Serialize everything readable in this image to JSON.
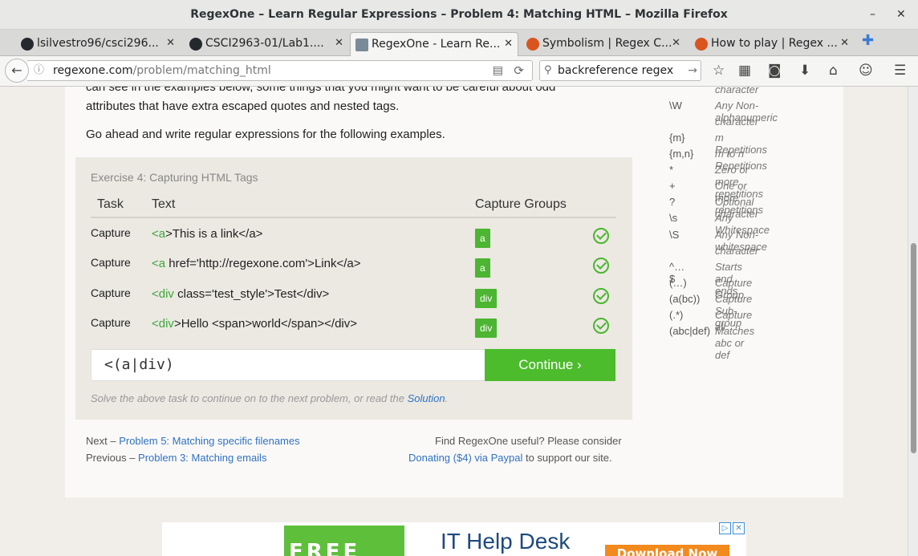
{
  "window": {
    "title": "RegexOne – Learn Regular Expressions – Problem 4: Matching HTML – Mozilla Firefox",
    "minimize": "–",
    "close": "✕"
  },
  "tabs": [
    {
      "label": "lsilvestro96/csci296...",
      "icon_color": "#24292e",
      "icon": "github-icon"
    },
    {
      "label": "CSCI2963-01/Lab1....",
      "icon_color": "#24292e",
      "icon": "github-icon"
    },
    {
      "label": "RegexOne - Learn Re...",
      "icon_color": "#7a8a99",
      "icon": "regexone-icon"
    },
    {
      "label": "Symbolism | Regex C...",
      "icon_color": "#d9541e",
      "icon": "crossword-icon"
    },
    {
      "label": "How to play | Regex ...",
      "icon_color": "#d9541e",
      "icon": "crossword-icon"
    }
  ],
  "tab_close": "✕",
  "new_tab": "✚",
  "nav": {
    "back": "←",
    "url_host": "regexone.com",
    "url_path": "/problem/matching_html",
    "reader": "▤",
    "reload": "⟳",
    "search_value": "backreference regex",
    "search_go": "→",
    "info": "ⓘ",
    "search_icon": "⚲"
  },
  "toolbar_icons": [
    "☆",
    "▦",
    "◙",
    "⬇",
    "⌂",
    "☺",
    "☰"
  ],
  "intro": {
    "line1": "can see in the examples below, some things that you might want to be careful about odd",
    "line2": "attributes that have extra escaped quotes and nested tags.",
    "line3": "Go ahead and write regular expressions for the following examples."
  },
  "exercise": {
    "title": "Exercise 4: Capturing HTML Tags",
    "headers": {
      "task": "Task",
      "text": "Text",
      "groups": "Capture Groups"
    },
    "rows": [
      {
        "task": "Capture",
        "hl": "<a",
        "rest": ">This is a link</a>",
        "group": "a"
      },
      {
        "task": "Capture",
        "hl": "<a",
        "rest": " href='http://regexone.com'>Link</a>",
        "group": "a"
      },
      {
        "task": "Capture",
        "hl": "<div",
        "rest": " class='test_style'>Test</div>",
        "group": "div"
      },
      {
        "task": "Capture",
        "hl": "<div",
        "rest": ">Hello <span>world</span></div>",
        "group": "div"
      }
    ],
    "answer": "<(a|div)",
    "continue": "Continue ›",
    "solve_prefix": "Solve the above task to continue on to the next problem, or read the ",
    "solve_link": "Solution",
    "solve_suffix": "."
  },
  "footer": {
    "next_prefix": "Next – ",
    "next_link": "Problem 5: Matching specific filenames",
    "prev_prefix": "Previous – ",
    "prev_link": "Problem 3: Matching emails",
    "useful": "Find RegexOne useful? Please consider",
    "donate_link": "Donating ($4) via Paypal",
    "donate_suffix": " to support our site."
  },
  "cheatsheet": [
    {
      "k": "",
      "v": "character"
    },
    {
      "k": "\\W",
      "v": "Any Non-alphanumeric"
    },
    {
      "k": "",
      "v": "character"
    },
    {
      "k": "{m}",
      "v": "m Repetitions"
    },
    {
      "k": "{m,n}",
      "v": "m to n Repetitions"
    },
    {
      "k": "*",
      "v": "Zero or more repetitions"
    },
    {
      "k": "+",
      "v": "One or more repetitions"
    },
    {
      "k": "?",
      "v": "Optional character"
    },
    {
      "k": "\\s",
      "v": "Any Whitespace"
    },
    {
      "k": "\\S",
      "v": "Any Non-whitespace"
    },
    {
      "k": "",
      "v": "character"
    },
    {
      "k": "^…$",
      "v": "Starts and ends"
    },
    {
      "k": "(…)",
      "v": "Capture Group"
    },
    {
      "k": "(a(bc))",
      "v": "Capture Sub-group"
    },
    {
      "k": "(.*)",
      "v": "Capture all"
    },
    {
      "k": "(abc|def)",
      "v": "Matches abc or def"
    }
  ],
  "ad": {
    "free": "FREE",
    "title": "IT Help Desk",
    "button": "Download Now",
    "adchoices": "▷",
    "close": "✕"
  }
}
